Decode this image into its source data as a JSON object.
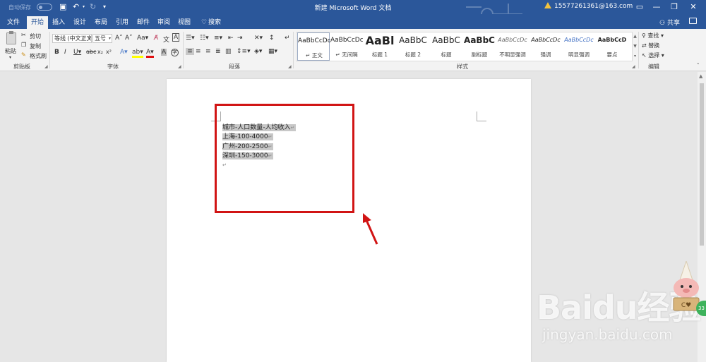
{
  "titlebar": {
    "autosave_label": "自动保存",
    "autosave_state": "关",
    "doc_title": "新建 Microsoft Word 文档",
    "account": "15577261361@163.com",
    "warning_icon": "warning-icon"
  },
  "tabs": [
    {
      "label": "文件",
      "active": false
    },
    {
      "label": "开始",
      "active": true
    },
    {
      "label": "插入",
      "active": false
    },
    {
      "label": "设计",
      "active": false
    },
    {
      "label": "布局",
      "active": false
    },
    {
      "label": "引用",
      "active": false
    },
    {
      "label": "邮件",
      "active": false
    },
    {
      "label": "审阅",
      "active": false
    },
    {
      "label": "视图",
      "active": false
    }
  ],
  "tell_me": "搜索",
  "share_label": "共享",
  "clipboard": {
    "paste": "粘贴",
    "cut": "剪切",
    "copy": "复制",
    "format_painter": "格式刷",
    "group_label": "剪贴板"
  },
  "font": {
    "font_name": "等线 (中文正文",
    "font_size": "五号",
    "group_label": "字体"
  },
  "paragraph": {
    "group_label": "段落"
  },
  "styles": {
    "items": [
      {
        "preview": "AaBbCcDc",
        "name": "正文",
        "size": 9,
        "bold": false,
        "selected": true
      },
      {
        "preview": "AaBbCcDc",
        "name": "无间隔",
        "size": 9,
        "bold": false,
        "selected": false
      },
      {
        "preview": "AaBl",
        "name": "标题 1",
        "size": 16,
        "bold": true,
        "selected": false
      },
      {
        "preview": "AaBbC",
        "name": "标题 2",
        "size": 12,
        "bold": false,
        "selected": false
      },
      {
        "preview": "AaBbC",
        "name": "标题",
        "size": 12,
        "bold": false,
        "selected": false
      },
      {
        "preview": "AaBbC",
        "name": "副标题",
        "size": 12,
        "bold": true,
        "selected": false
      },
      {
        "preview": "AaBbCcDc",
        "name": "不明显强调",
        "size": 8,
        "bold": false,
        "selected": false
      },
      {
        "preview": "AaBbCcDc",
        "name": "强调",
        "size": 8,
        "bold": false,
        "selected": false
      },
      {
        "preview": "AaBbCcDc",
        "name": "明显强调",
        "size": 8,
        "bold": false,
        "selected": false
      },
      {
        "preview": "AaBbCcD",
        "name": "要点",
        "size": 8,
        "bold": true,
        "selected": false
      }
    ],
    "group_label": "样式"
  },
  "editing": {
    "find": "查找",
    "replace": "替换",
    "select": "选择",
    "group_label": "编辑"
  },
  "document": {
    "lines": [
      "城市-人口数量-人均收入",
      "上海-100-4000",
      "广州-200-2500",
      "深圳-150-3000"
    ],
    "paragraph_mark": "↵"
  },
  "watermark": {
    "logo": "Baidu经验",
    "url": "jingyan.baidu.com"
  },
  "colors": {
    "word_blue": "#2b579a",
    "highlight": "#c8c8c8",
    "red_box": "#d11414"
  }
}
